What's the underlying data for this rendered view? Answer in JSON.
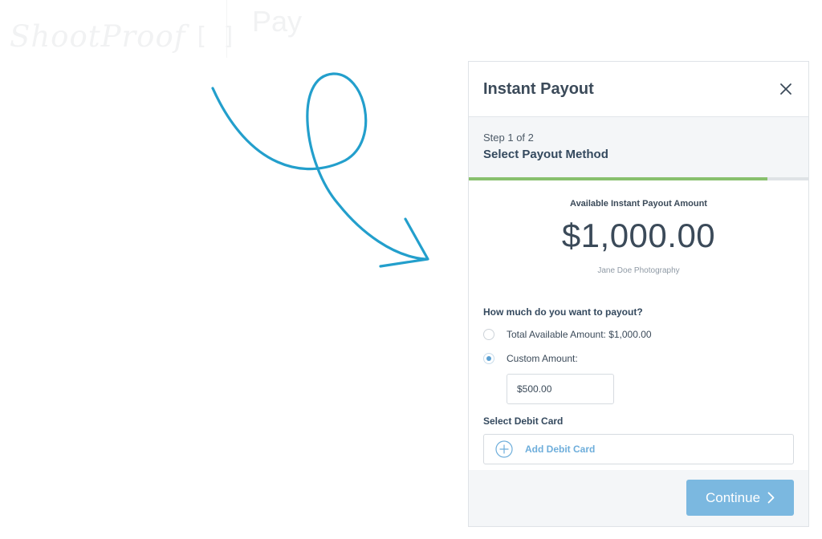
{
  "brand": {
    "logo_text": "ShootProof",
    "product": "Pay"
  },
  "modal": {
    "title": "Instant Payout",
    "step": {
      "count": "Step 1 of 2",
      "name": "Select Payout Method",
      "progress": 0.88
    },
    "payout": {
      "label": "Available Instant Payout Amount",
      "amount": "$1,000.00",
      "owner": "Jane Doe Photography"
    },
    "form": {
      "question": "How much do you want to payout?",
      "options": [
        {
          "label": "Total Available Amount: $1,000.00",
          "selected": false
        },
        {
          "label": "Custom Amount:",
          "selected": true
        }
      ],
      "custom_amount_value": "$500.00"
    },
    "debit": {
      "heading": "Select Debit Card",
      "add_label": "Add Debit Card"
    },
    "continue_label": "Continue"
  },
  "colors": {
    "accent_arrow": "#239fcc",
    "progress": "#88c06e",
    "button": "#7bb8e0",
    "link": "#6eaedb"
  },
  "icons": {
    "close": "close-icon",
    "add_card": "plus-circle-icon",
    "continue": "chevron-right-icon",
    "decoration": "loop-arrow-icon"
  }
}
